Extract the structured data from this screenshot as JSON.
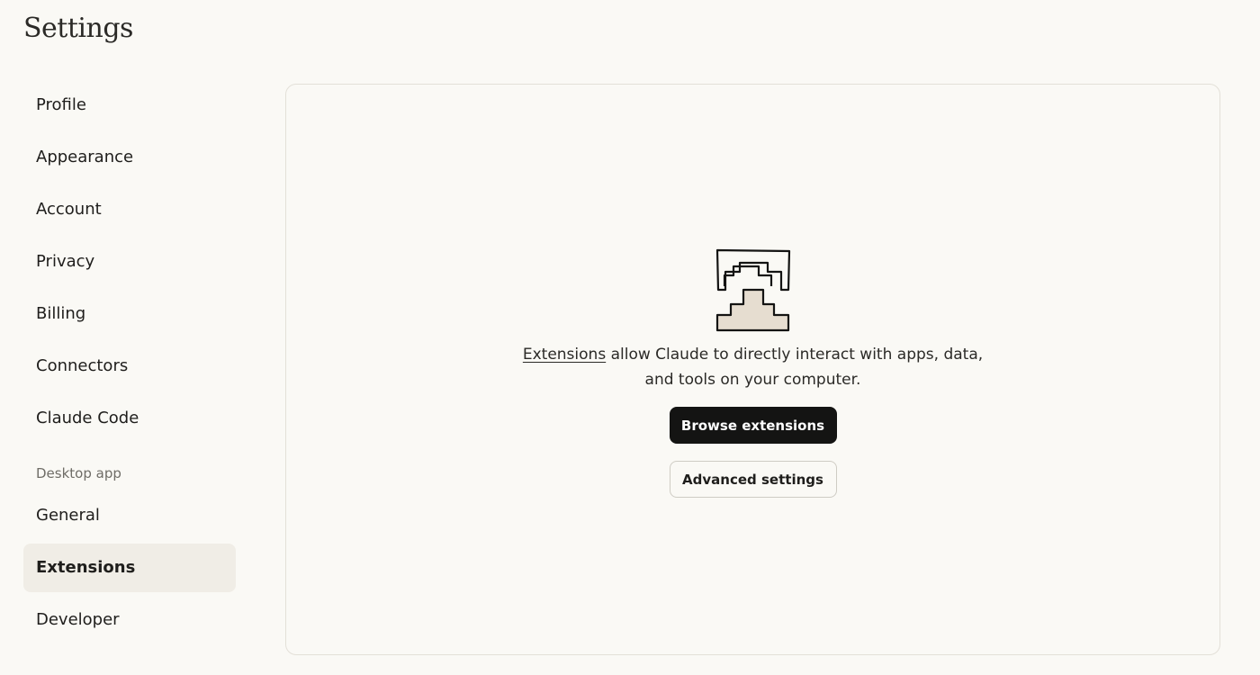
{
  "page": {
    "title": "Settings"
  },
  "sidebar": {
    "items": [
      {
        "label": "Profile"
      },
      {
        "label": "Appearance"
      },
      {
        "label": "Account"
      },
      {
        "label": "Privacy"
      },
      {
        "label": "Billing"
      },
      {
        "label": "Connectors"
      },
      {
        "label": "Claude Code"
      }
    ],
    "section_label": "Desktop app",
    "desktop_items": [
      {
        "label": "General",
        "active": false
      },
      {
        "label": "Extensions",
        "active": true
      },
      {
        "label": "Developer",
        "active": false
      }
    ]
  },
  "main": {
    "illustration_icon": "extensions-stack-icon",
    "description_link": "Extensions",
    "description_line1": " allow Claude to directly interact with apps, data,",
    "description_line2": "and tools on your computer.",
    "browse_button": "Browse extensions",
    "advanced_button": "Advanced settings"
  },
  "colors": {
    "background": "#faf9f5",
    "active_item_bg": "#f0ede6",
    "primary_button": "#141413",
    "illustration_fill": "#e6ddd0"
  }
}
